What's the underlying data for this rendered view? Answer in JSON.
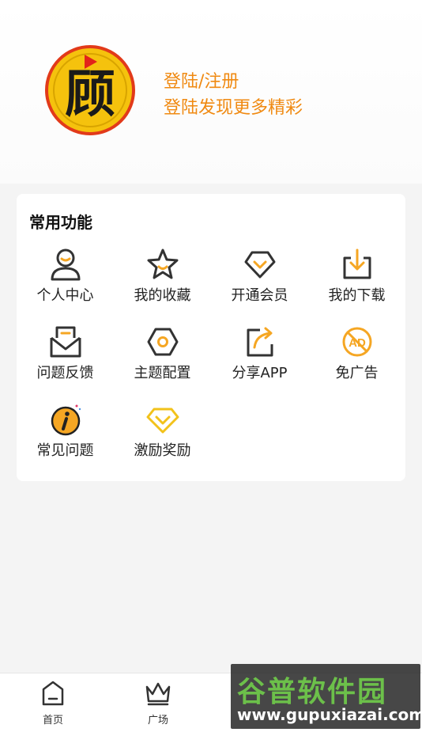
{
  "profile": {
    "avatar_glyph": "顾",
    "login_title": "登陆/注册",
    "login_subtitle": "登陆发现更多精彩"
  },
  "functions": {
    "title": "常用功能",
    "items": [
      {
        "label": "个人中心",
        "icon": "user-icon"
      },
      {
        "label": "我的收藏",
        "icon": "star-icon"
      },
      {
        "label": "开通会员",
        "icon": "vip-diamond-icon"
      },
      {
        "label": "我的下载",
        "icon": "download-icon"
      },
      {
        "label": "问题反馈",
        "icon": "envelope-icon"
      },
      {
        "label": "主题配置",
        "icon": "hexagon-settings-icon"
      },
      {
        "label": "分享APP",
        "icon": "share-icon"
      },
      {
        "label": "免广告",
        "icon": "no-ad-icon"
      },
      {
        "label": "常见问题",
        "icon": "info-icon"
      },
      {
        "label": "激励奖励",
        "icon": "reward-diamond-icon"
      }
    ]
  },
  "nav": {
    "items": [
      {
        "label": "首页",
        "icon": "home-icon"
      },
      {
        "label": "广场",
        "icon": "crown-icon"
      }
    ]
  },
  "watermark": {
    "line1": "谷普软件园",
    "line2": "www.gupuxiazai.com"
  },
  "colors": {
    "accent": "#f08a12",
    "icon_dark": "#333333",
    "icon_orange": "#f5a623",
    "icon_gold": "#f2c21b"
  }
}
